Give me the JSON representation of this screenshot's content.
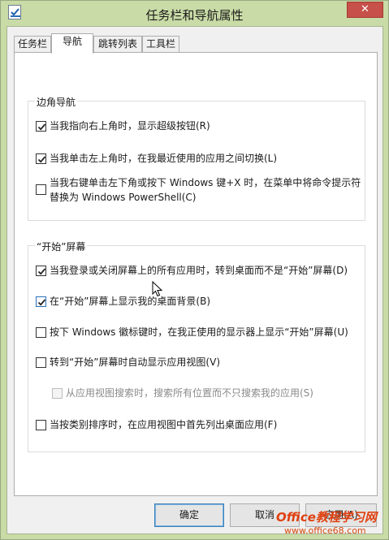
{
  "window": {
    "title": "任务栏和导航属性",
    "close_symbol": "✕"
  },
  "tabs": [
    {
      "label": "任务栏",
      "active": false
    },
    {
      "label": "导航",
      "active": true
    },
    {
      "label": "跳转列表",
      "active": false
    },
    {
      "label": "工具栏",
      "active": false
    }
  ],
  "corner_nav": {
    "title": "边角导航",
    "options": [
      {
        "label": "当我指向右上角时，显示超级按钮(R)",
        "checked": true
      },
      {
        "label": "当我单击左上角时，在我最近使用的应用之间切换(L)",
        "checked": true
      },
      {
        "label_line1": "当我右键单击左下角或按下 Windows 键+X 时，在菜单中将命令提示符",
        "label_line2": "替换为 Windows PowerShell(C)",
        "checked": false
      }
    ]
  },
  "start_screen": {
    "title": "“开始”屏幕",
    "options": [
      {
        "label": "当我登录或关闭屏幕上的所有应用时，转到桌面而不是“开始”屏幕(D)",
        "checked": true
      },
      {
        "label": "在“开始”屏幕上显示我的桌面背景(B)",
        "checked": true
      },
      {
        "label": "按下 Windows 徽标键时，在我正使用的显示器上显示“开始”屏幕(U)",
        "checked": false
      },
      {
        "label": "转到“开始”屏幕时自动显示应用视图(V)",
        "checked": false
      },
      {
        "label": "从应用视图搜索时，搜索所有位置而不只搜索我的应用(S)",
        "checked": false,
        "disabled": true
      },
      {
        "label": "当按类别排序时，在应用视图中首先列出桌面应用(F)",
        "checked": false
      }
    ]
  },
  "buttons": {
    "ok": "确定",
    "cancel": "取消",
    "apply": "应用(A)"
  },
  "watermark": {
    "line1": "Office教程学习网",
    "line2": "www.office68.com"
  },
  "colors": {
    "frame": "#c9dba6",
    "close": "#c7504a",
    "watermark": "#e04010"
  }
}
